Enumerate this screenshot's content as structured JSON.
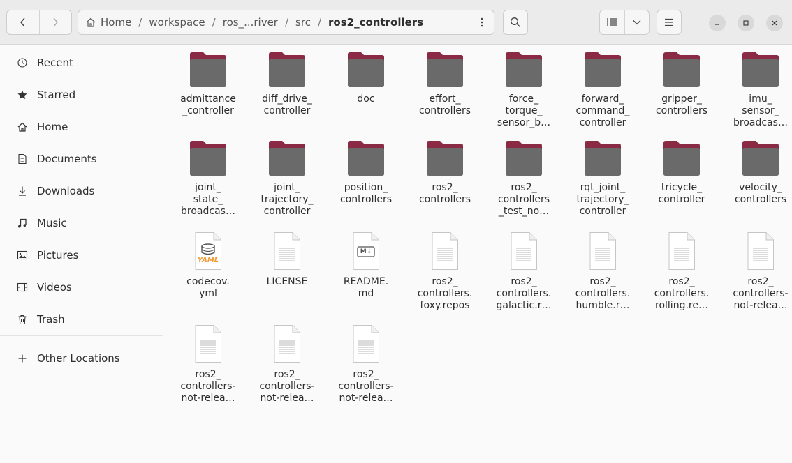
{
  "header": {
    "path": [
      {
        "label": "Home"
      },
      {
        "label": "workspace"
      },
      {
        "label": "ros_...river"
      },
      {
        "label": "src"
      },
      {
        "label": "ros2_controllers"
      }
    ],
    "path_menu_icon": "vertical-ellipsis-icon",
    "search_icon": "search-icon",
    "view_icon": "list-view-icon",
    "view_dropdown_icon": "chevron-down-icon",
    "menu_icon": "hamburger-menu-icon"
  },
  "sidebar": {
    "items": [
      {
        "label": "Recent",
        "icon": "clock-icon"
      },
      {
        "label": "Starred",
        "icon": "star-icon"
      },
      {
        "label": "Home",
        "icon": "home-icon"
      },
      {
        "label": "Documents",
        "icon": "document-icon"
      },
      {
        "label": "Downloads",
        "icon": "download-icon"
      },
      {
        "label": "Music",
        "icon": "music-note-icon"
      },
      {
        "label": "Pictures",
        "icon": "picture-icon"
      },
      {
        "label": "Videos",
        "icon": "film-icon"
      },
      {
        "label": "Trash",
        "icon": "trash-icon"
      },
      {
        "label": "Other Locations",
        "icon": "plus-icon"
      }
    ]
  },
  "colors": {
    "folder_tab": "#8a2a45",
    "folder_body": "#6a6a6a",
    "yaml_accent": "#f29c38",
    "accent_window": "#d9d9d9"
  },
  "files": [
    {
      "label": "admittance\n_controller",
      "type": "folder"
    },
    {
      "label": "diff_drive_\ncontroller",
      "type": "folder"
    },
    {
      "label": "doc",
      "type": "folder"
    },
    {
      "label": "effort_\ncontrollers",
      "type": "folder"
    },
    {
      "label": "force_\ntorque_\nsensor_b…",
      "type": "folder"
    },
    {
      "label": "forward_\ncommand_\ncontroller",
      "type": "folder"
    },
    {
      "label": "gripper_\ncontrollers",
      "type": "folder"
    },
    {
      "label": "imu_\nsensor_\nbroadcas…",
      "type": "folder"
    },
    {
      "label": "joint_\nstate_\nbroadcas…",
      "type": "folder"
    },
    {
      "label": "joint_\ntrajectory_\ncontroller",
      "type": "folder"
    },
    {
      "label": "position_\ncontrollers",
      "type": "folder"
    },
    {
      "label": "ros2_\ncontrollers",
      "type": "folder"
    },
    {
      "label": "ros2_\ncontrollers\n_test_no…",
      "type": "folder"
    },
    {
      "label": "rqt_joint_\ntrajectory_\ncontroller",
      "type": "folder"
    },
    {
      "label": "tricycle_\ncontroller",
      "type": "folder"
    },
    {
      "label": "velocity_\ncontrollers",
      "type": "folder"
    },
    {
      "label": "codecov.\nyml",
      "type": "yaml",
      "badge": "YAML"
    },
    {
      "label": "LICENSE",
      "type": "text"
    },
    {
      "label": "README.\nmd",
      "type": "markdown",
      "badge": "M↓"
    },
    {
      "label": "ros2_\ncontrollers.\nfoxy.repos",
      "type": "text"
    },
    {
      "label": "ros2_\ncontrollers.\ngalactic.r…",
      "type": "text"
    },
    {
      "label": "ros2_\ncontrollers.\nhumble.r…",
      "type": "text"
    },
    {
      "label": "ros2_\ncontrollers.\nrolling.re…",
      "type": "text"
    },
    {
      "label": "ros2_\ncontrollers-\nnot-relea…",
      "type": "text"
    },
    {
      "label": "ros2_\ncontrollers-\nnot-relea…",
      "type": "text"
    },
    {
      "label": "ros2_\ncontrollers-\nnot-relea…",
      "type": "text"
    },
    {
      "label": "ros2_\ncontrollers-\nnot-relea…",
      "type": "text"
    }
  ]
}
